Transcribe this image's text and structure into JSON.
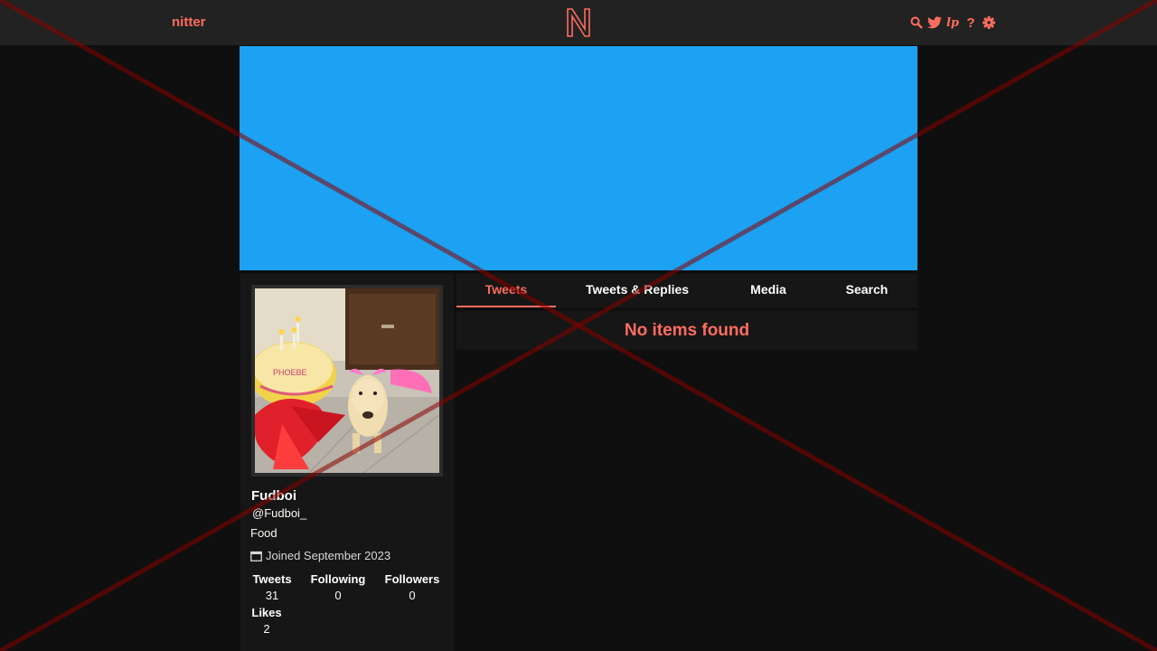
{
  "nav": {
    "brand": "nitter",
    "logo_letter": "N",
    "icons": [
      "search-icon",
      "twitter-bird-icon",
      "libreddit-icon",
      "help-icon",
      "gear-icon"
    ],
    "lp_label": "lp",
    "help_label": "?"
  },
  "banner": {
    "color": "#1da1f2"
  },
  "profile": {
    "fullname": "Fudboi",
    "username": "@Fudboi_",
    "bio": "Food",
    "joindate": "Joined September 2023",
    "stats": {
      "tweets_label": "Tweets",
      "tweets": "31",
      "following_label": "Following",
      "following": "0",
      "followers_label": "Followers",
      "followers": "0",
      "likes_label": "Likes",
      "likes": "2"
    }
  },
  "tabs": [
    {
      "label": "Tweets",
      "active": true
    },
    {
      "label": "Tweets & Replies",
      "active": false
    },
    {
      "label": "Media",
      "active": false
    },
    {
      "label": "Search",
      "active": false
    }
  ],
  "timeline": {
    "message": "No items found"
  },
  "colors": {
    "accent": "#ff6c60",
    "navbar": "#222222",
    "background": "#0f0f0f",
    "panel": "#161616",
    "overlay_cross": "#8b0000"
  }
}
